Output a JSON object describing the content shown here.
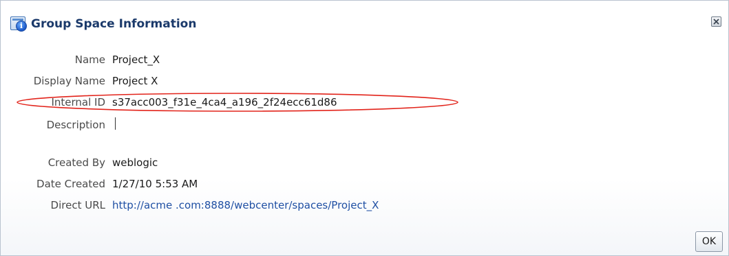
{
  "dialog": {
    "title": "Group Space Information",
    "close_icon": "close-icon",
    "ok_label": "OK"
  },
  "fields": {
    "name": {
      "label": "Name",
      "value": "Project_X"
    },
    "display_name": {
      "label": "Display Name",
      "value": "Project X"
    },
    "internal_id": {
      "label": "Internal ID",
      "value": "s37acc003_f31e_4ca4_a196_2f24ecc61d86"
    },
    "description": {
      "label": "Description",
      "value": ""
    },
    "created_by": {
      "label": "Created By",
      "value": "weblogic"
    },
    "date_created": {
      "label": "Date Created",
      "value": "1/27/10 5:53 AM"
    },
    "direct_url": {
      "label": "Direct URL",
      "value": "http://acme .com:8888/webcenter/spaces/Project_X"
    }
  },
  "colors": {
    "title": "#1b3a6b",
    "link": "#1f4fa3",
    "highlight": "#e2231a"
  }
}
